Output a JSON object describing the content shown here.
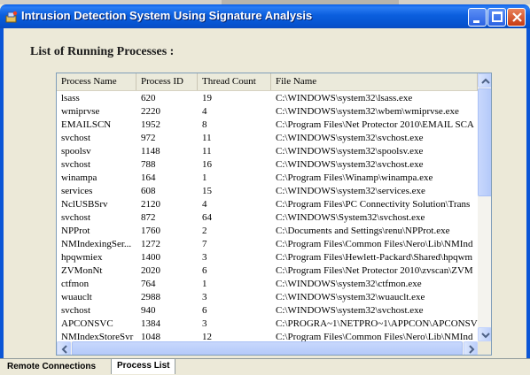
{
  "window": {
    "title": "Intrusion Detection System Using Signature Analysis",
    "app_icon": "app-icon",
    "controls": [
      "minimize-icon",
      "maximize-icon",
      "close-icon"
    ]
  },
  "section": {
    "heading": "List of Running Processes :"
  },
  "process_table": {
    "columns": [
      "Process Name",
      "Process ID",
      "Thread Count",
      "File Name"
    ],
    "rows": [
      [
        "lsass",
        "620",
        "19",
        "C:\\WINDOWS\\system32\\lsass.exe"
      ],
      [
        "wmiprvse",
        "2220",
        "4",
        "C:\\WINDOWS\\system32\\wbem\\wmiprvse.exe"
      ],
      [
        "EMAILSCN",
        "1952",
        "8",
        "C:\\Program Files\\Net Protector 2010\\EMAIL SCA"
      ],
      [
        "svchost",
        "972",
        "11",
        "C:\\WINDOWS\\system32\\svchost.exe"
      ],
      [
        "spoolsv",
        "1148",
        "11",
        "C:\\WINDOWS\\system32\\spoolsv.exe"
      ],
      [
        "svchost",
        "788",
        "16",
        "C:\\WINDOWS\\system32\\svchost.exe"
      ],
      [
        "winampa",
        "164",
        "1",
        "C:\\Program Files\\Winamp\\winampa.exe"
      ],
      [
        "services",
        "608",
        "15",
        "C:\\WINDOWS\\system32\\services.exe"
      ],
      [
        "NclUSBSrv",
        "2120",
        "4",
        "C:\\Program Files\\PC Connectivity Solution\\Trans"
      ],
      [
        "svchost",
        "872",
        "64",
        "C:\\WINDOWS\\System32\\svchost.exe"
      ],
      [
        "NPProt",
        "1760",
        "2",
        "C:\\Documents and Settings\\renu\\NPProt.exe"
      ],
      [
        "NMIndexingSer...",
        "1272",
        "7",
        "C:\\Program Files\\Common Files\\Nero\\Lib\\NMInd"
      ],
      [
        "hpqwmiex",
        "1400",
        "3",
        "C:\\Program Files\\Hewlett-Packard\\Shared\\hpqwm"
      ],
      [
        "ZVMonNt",
        "2020",
        "6",
        "C:\\Program Files\\Net Protector 2010\\zvscan\\ZVM"
      ],
      [
        "ctfmon",
        "764",
        "1",
        "C:\\WINDOWS\\system32\\ctfmon.exe"
      ],
      [
        "wuauclt",
        "2988",
        "3",
        "C:\\WINDOWS\\system32\\wuauclt.exe"
      ],
      [
        "svchost",
        "940",
        "6",
        "C:\\WINDOWS\\system32\\svchost.exe"
      ],
      [
        "APCONSVC",
        "1384",
        "3",
        "C:\\PROGRA~1\\NETPRO~1\\APPCON\\APCONSV"
      ],
      [
        "NMIndexStoreSvr",
        "1048",
        "12",
        "C:\\Program Files\\Common Files\\Nero\\Lib\\NMInd"
      ]
    ],
    "scrollbar_icons": [
      "scroll-up-icon",
      "scroll-down-icon",
      "scroll-left-icon",
      "scroll-right-icon"
    ]
  },
  "tabs": [
    {
      "label": "Remote Connections"
    },
    {
      "label": "Process List"
    }
  ],
  "colors": {
    "titlebar": "#0a5fe8",
    "window_bg": "#ece9d8",
    "list_border": "#7f9db9",
    "close_button": "#c73b12"
  }
}
